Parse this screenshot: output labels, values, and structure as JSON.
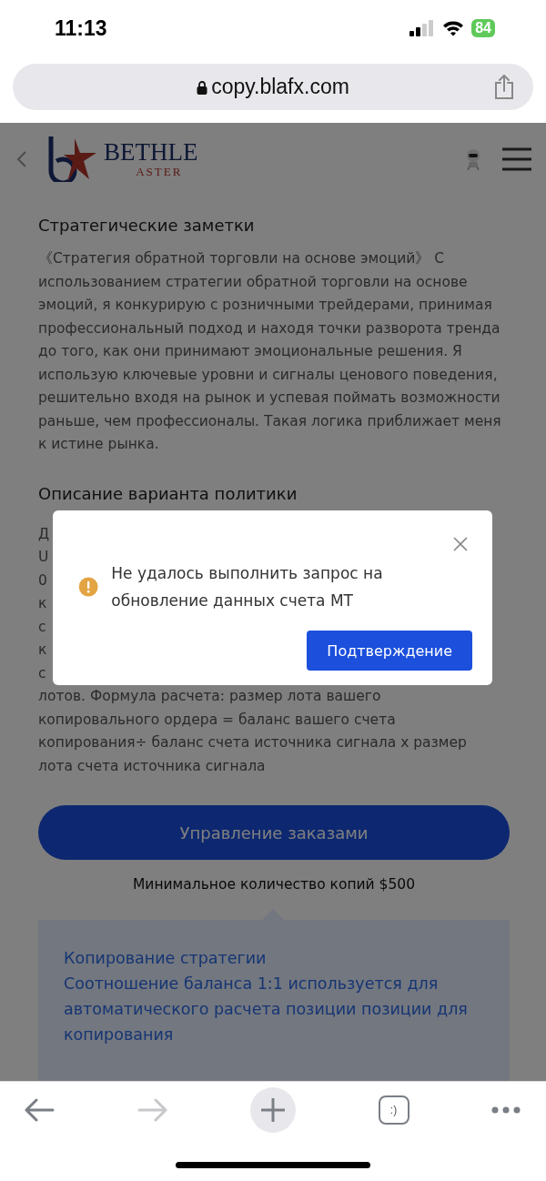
{
  "status_bar": {
    "time": "11:13",
    "battery": "84"
  },
  "address_bar": {
    "url": "copy.blafx.com"
  },
  "header": {
    "logo_top": "BETHLE",
    "logo_bottom": "ASTER"
  },
  "notes": {
    "title": "Стратегические заметки",
    "text": "《Стратегия обратной торговли на основе эмоций》 С использованием стратегии обратной торговли на основе эмоций, я конкурирую с розничными трейдерами, принимая профессиональный подход и находя точки разворота тренда до того, как они принимают эмоциональные решения. Я использую ключевые уровни и сигналы ценового поведения, решительно входя на рынок и успевая поймать возможности раньше, чем профессионалы. Такая логика приближает меня к истине рынка."
  },
  "policy": {
    "title": "Описание варианта политики",
    "fragments": [
      "Д",
      "U",
      "0",
      "к",
      "с",
      "к",
      "с"
    ],
    "lines": [
      "лотов. Формула расчета: размер лота вашего",
      "копировального ордера = баланс вашего счета",
      "копирования÷ баланс счета источника сигнала х размер",
      "лота счета источника сигнала"
    ]
  },
  "order_button": "Управление заказами",
  "min_copy": "Минимальное количество копий $500",
  "info": {
    "title": "Копирование стратегии",
    "text": "Соотношение баланса 1:1 используется для автоматического расчета позиции позиции для копирования"
  },
  "dialog": {
    "message": "Не удалось выполнить запрос на обновление данных счета MT",
    "confirm": "Подтверждение"
  },
  "toolbar": {
    "tabs_label": ":)"
  }
}
